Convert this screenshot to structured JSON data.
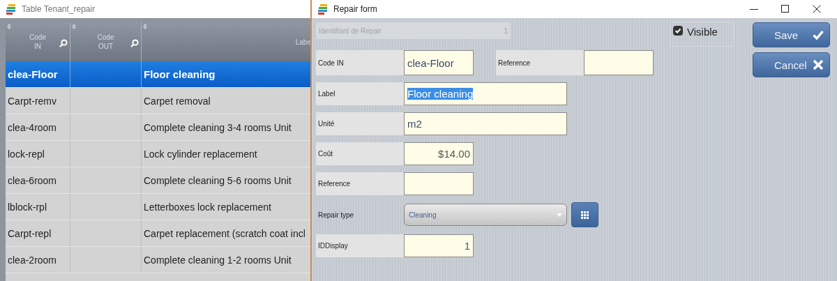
{
  "table_window": {
    "title": "Table Tenant_repair",
    "columns": [
      {
        "label": "Code IN",
        "filter": true
      },
      {
        "label": "Code OUT",
        "filter": true
      },
      {
        "label": "Labe",
        "filter": false
      }
    ],
    "rows": [
      {
        "code_in": "clea-Floor",
        "label": "Floor cleaning",
        "selected": true
      },
      {
        "code_in": "Carpt-remv",
        "label": "Carpet removal",
        "selected": false
      },
      {
        "code_in": "clea-4room",
        "label": "Complete cleaning 3-4 rooms Unit",
        "selected": false
      },
      {
        "code_in": "lock-repl",
        "label": "Lock cylinder replacement",
        "selected": false
      },
      {
        "code_in": "clea-6room",
        "label": "Complete cleaning 5-6 rooms Unit",
        "selected": false
      },
      {
        "code_in": "lblock-rpl",
        "label": "Letterboxes lock replacement",
        "selected": false
      },
      {
        "code_in": "Carpt-repl",
        "label": "Carpet replacement (scratch coat incl",
        "selected": false
      },
      {
        "code_in": "clea-2room",
        "label": "Complete cleaning 1-2 rooms Unit",
        "selected": false
      }
    ]
  },
  "form_window": {
    "title": "Repair form",
    "rows": [
      {
        "fields": [
          {
            "kind": "disabled",
            "label": "Identifiant de Repair",
            "value": "1"
          }
        ]
      },
      {
        "fields": [
          {
            "kind": "text",
            "label": "Code IN",
            "value": "clea-Floor"
          },
          {
            "kind": "text",
            "label": "Reference"
          }
        ]
      },
      {
        "fields": [
          {
            "kind": "text",
            "label": "Label",
            "value": "Floor cleaning",
            "highlighted": true
          }
        ]
      },
      {
        "fields": [
          {
            "kind": "text",
            "label": "Unité",
            "value": "m2"
          }
        ]
      },
      {
        "fields": [
          {
            "kind": "number",
            "label": "Coût",
            "value": "$14.00"
          }
        ]
      },
      {
        "fields": [
          {
            "kind": "text",
            "label": "Reference"
          }
        ]
      },
      {
        "fields": [
          {
            "kind": "select",
            "label": "Repair type",
            "value": "Cleaning"
          }
        ]
      },
      {
        "fields": [
          {
            "kind": "number",
            "label": "IDDisplay",
            "value": "1"
          }
        ]
      }
    ],
    "visible": {
      "label": "Visible",
      "checked": true
    },
    "buttons": [
      {
        "label": "Save",
        "kind": "save"
      },
      {
        "label": "Cancel",
        "kind": "cancel"
      }
    ]
  }
}
